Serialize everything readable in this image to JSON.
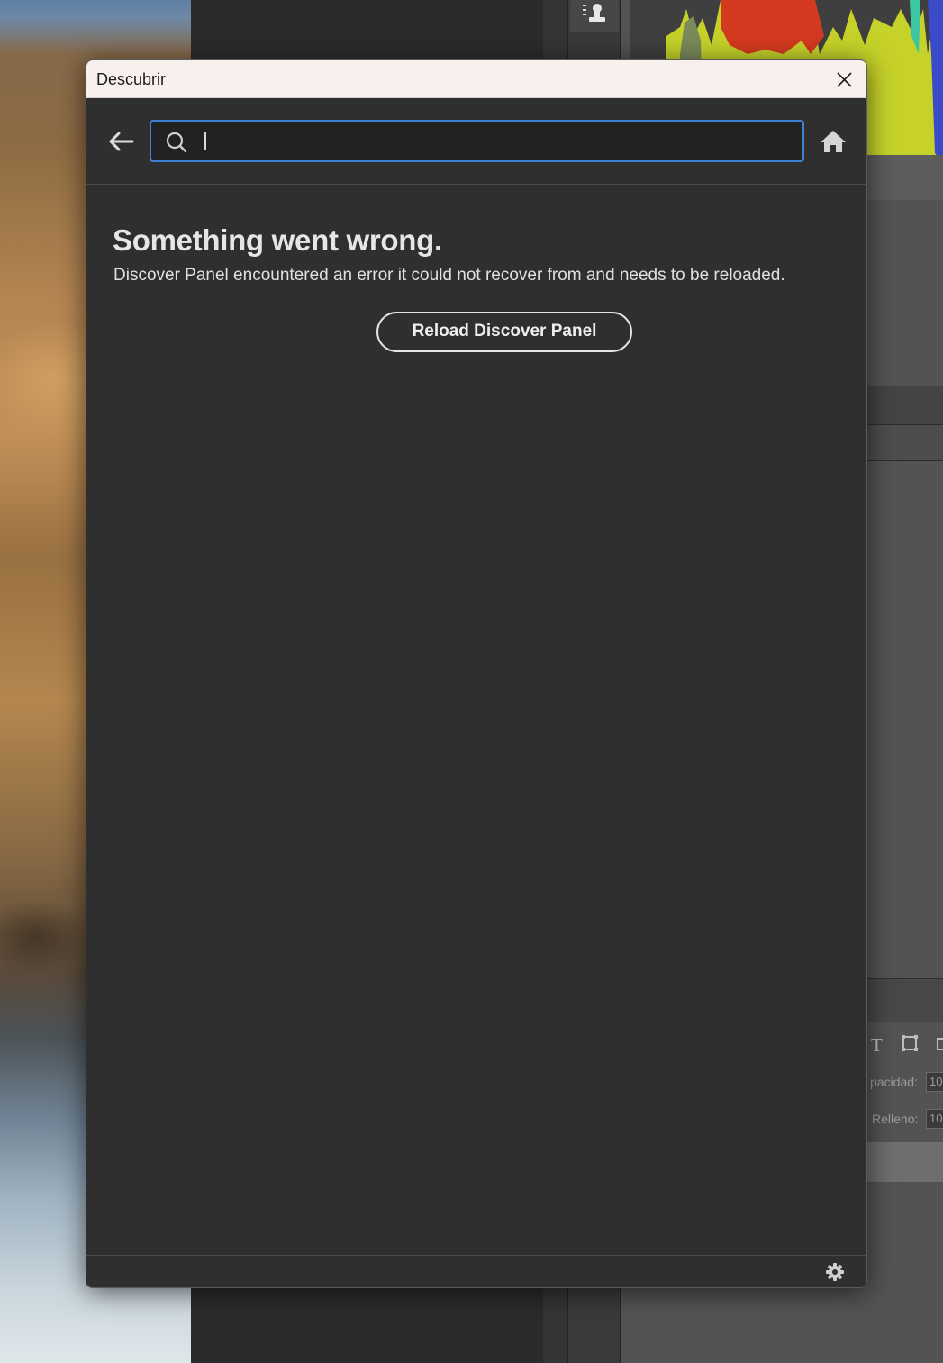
{
  "background": {
    "opacity_label": "pacidad:",
    "opacity_value": "10",
    "fill_label": "Relleno:",
    "fill_value": "10"
  },
  "dialog": {
    "title": "Descubrir",
    "search": {
      "placeholder": "",
      "value": ""
    },
    "error": {
      "heading": "Something went wrong.",
      "message": "Discover Panel encountered an error it could not recover from and needs to be reloaded.",
      "reload_label": "Reload Discover Panel"
    }
  },
  "icons": {
    "close": "close-icon",
    "back": "back-arrow-icon",
    "search": "search-icon",
    "home": "home-icon",
    "settings": "gear-icon"
  },
  "colors": {
    "titlebar": "#f8f0ec",
    "panel_bg": "#2f2f2f",
    "search_focus": "#3f7fd4",
    "text": "#e6e6e6"
  }
}
